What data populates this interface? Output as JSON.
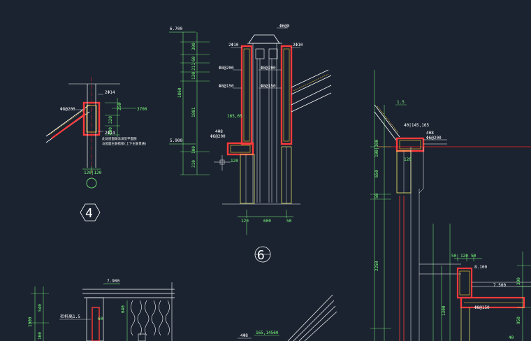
{
  "detail4": {
    "number": "4",
    "dim_bottom": "120|120",
    "rebar_top": "2Φ14",
    "rebar_bot": "2Φ14",
    "stirrup": "Φ8@200",
    "dim_a": "250",
    "dim_b": "320",
    "dim_c": "400",
    "note_line1": "此处屋面做法详见平面图",
    "note_line2": "与屋面主筋搭接(上下主筋贯通)",
    "side_tag": "3700"
  },
  "detail6": {
    "number": "6",
    "top_elev": "6.700",
    "mid_elev": "5.900",
    "dims_vertical": [
      "300",
      "60",
      "211",
      "130",
      "1860",
      "1081",
      "100",
      "310"
    ],
    "rebar_left": "2Φ10",
    "rebar_right": "2Φ10",
    "tag_top": "Φ6@8",
    "stirrup_l1": "Φ8@200",
    "stirrup_r1": "Φ8@200",
    "stirrup_l2": "Φ8@150",
    "stirrup_r2": "Φ8@150",
    "dim_165": "165,65",
    "small_tag": "4Φ8",
    "small_tag2": "Φ6@200",
    "dim_120": "120",
    "dims_bottom": [
      "120",
      "600",
      "50"
    ]
  },
  "right_section": {
    "top_dim": "1.5",
    "dims_top": "40|145,165",
    "tag1": "4Φ8",
    "tag2": "Φ6@200",
    "dim_120": "120",
    "left_dims": [
      "100|100",
      "650",
      "50",
      "2250",
      "1300"
    ],
    "elev_1": "8.100",
    "elev_2": "7.500",
    "dims_top2": [
      "50",
      "120",
      "50"
    ],
    "tag3": "Φ8@150",
    "right_dims": [
      "300",
      "950",
      "40"
    ]
  },
  "bottom_left": {
    "elev": "7.900",
    "tag": "栏杆高1.5",
    "dims_left": [
      "1000",
      "540",
      "160"
    ],
    "dim_540": "540",
    "dim_60": "60",
    "dim_640": "640"
  },
  "bottom_center": {
    "tag1": "4Φ8",
    "dims": "165,14560"
  },
  "colors": {
    "background": "#1b2330",
    "dimension": "#7cff7c",
    "concrete": "#ff3a3a",
    "rebar": "#ffcc33",
    "outline": "#ffffff",
    "hatch": "#f4f46a",
    "axis": "#ff2020"
  }
}
